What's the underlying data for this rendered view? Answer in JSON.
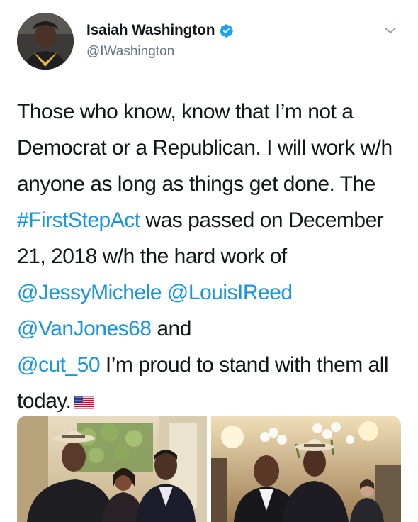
{
  "author": {
    "display_name": "Isaiah Washington",
    "handle": "@IWashington",
    "verified": true,
    "verified_color": "#1da1f2"
  },
  "tweet": {
    "text_segments": [
      {
        "text": "Those who know, know that I’m not a Democrat or a Republican. I will work w/h anyone as long as things get done. The ",
        "type": "text"
      },
      {
        "text": "#FirstStepAct",
        "type": "hashtag"
      },
      {
        "text": " was passed on December 21, 2018 w/h the hard work of ",
        "type": "text"
      },
      {
        "text": "@JessyMichele",
        "type": "mention"
      },
      {
        "text": " ",
        "type": "text"
      },
      {
        "text": "@LouisIReed",
        "type": "mention"
      },
      {
        "text": " ",
        "type": "text"
      },
      {
        "text": "@VanJones68",
        "type": "mention"
      },
      {
        "text": " and ",
        "type": "text"
      },
      {
        "text": "@cut_50",
        "type": "mention"
      },
      {
        "text": " I’m proud to stand with them all today.",
        "type": "text"
      }
    ],
    "emoji": "us-flag-emoji",
    "link_color": "#1b95e0"
  },
  "media": {
    "photos": [
      {
        "name": "photo-group-three-people",
        "description_icon": "photo-icon"
      },
      {
        "name": "photo-two-men-event",
        "description_icon": "photo-icon"
      }
    ]
  },
  "icons": {
    "caret": "chevron-down-icon",
    "verified": "verified-badge-icon"
  }
}
